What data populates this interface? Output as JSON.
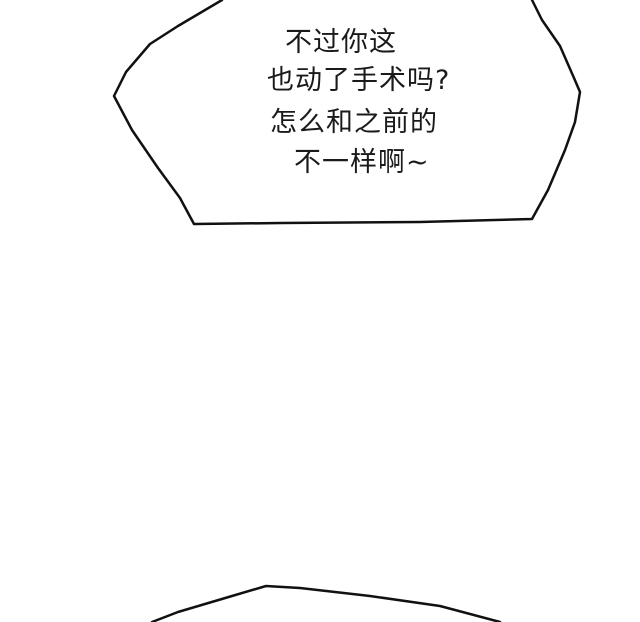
{
  "speech_bubble": {
    "lines": [
      "不过你这",
      "也动了手术吗?",
      "怎么和之前的",
      "不一样啊~"
    ]
  },
  "colors": {
    "background": "#ffffff",
    "outline": "#111111",
    "text": "#1a1a1a"
  }
}
